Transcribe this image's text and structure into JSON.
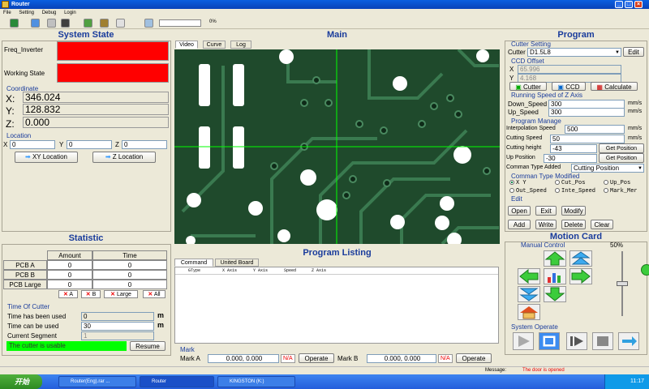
{
  "window": {
    "title": "Router",
    "btn_min": "_",
    "btn_max": "□",
    "btn_close": "×"
  },
  "menu": [
    "File",
    "Setting",
    "Debug",
    "Login"
  ],
  "toolbar": {
    "progress_pct": "0%",
    "progress_value": 0
  },
  "system_state": {
    "title": "System State",
    "freq_inverter_label": "Freq_Inverter",
    "working_state_label": "Working State",
    "coordinate_group": "Coordinate",
    "x_label": "X:",
    "x_value": "346.024",
    "y_label": "Y:",
    "y_value": "128.832",
    "z_label": "Z:",
    "z_value": "0.000",
    "location_group": "Location",
    "loc_x_label": "X",
    "loc_x": "0",
    "loc_y_label": "Y",
    "loc_y": "0",
    "loc_z_label": "Z",
    "loc_z": "0",
    "xy_location_btn": "XY Location",
    "z_location_btn": "Z Location"
  },
  "statistic": {
    "title": "Statistic",
    "headers": [
      "Amount",
      "Time"
    ],
    "rows": [
      {
        "name": "PCB A",
        "amount": "0",
        "time": "0"
      },
      {
        "name": "PCB B",
        "amount": "0",
        "time": "0"
      },
      {
        "name": "PCB Large",
        "amount": "0",
        "time": "0"
      }
    ],
    "clear_a": "A",
    "clear_b": "B",
    "clear_large": "Large",
    "clear_all": "All",
    "time_group": "Time Of Cutter",
    "time_used_label": "Time has been used",
    "time_used": "0",
    "time_used_unit": "m",
    "time_can_label": "Time can be used",
    "time_can": "30",
    "time_can_unit": "m",
    "segment_label": "Current Segment",
    "segment": "1",
    "status": "The cutter is usable",
    "resume_btn": "Resume"
  },
  "main": {
    "title": "Main",
    "tabs": [
      "Video",
      "Curve",
      "Log"
    ]
  },
  "program_listing": {
    "title": "Program Listing",
    "tabs": [
      "Command",
      "United Board"
    ],
    "columns": [
      "GType",
      "X Axis",
      "Y Axis",
      "Speed",
      "Z Axis"
    ],
    "mark_group": "Mark",
    "mark_a_label": "Mark A",
    "mark_a_value": "0.000, 0.000",
    "mark_a_na": "N/A",
    "mark_a_btn": "Operate",
    "mark_b_label": "Mark B",
    "mark_b_value": "0.000, 0.000",
    "mark_b_na": "N/A",
    "mark_b_btn": "Operate"
  },
  "program": {
    "title": "Program",
    "cutter_setting_group": "Cutter Setting",
    "cutter_label": "Cutter",
    "cutter_value": "D1.5L8",
    "edit_btn": "Edit",
    "ccd_offset_group": "CCD Offset",
    "ccd_x_label": "X",
    "ccd_x": "65.996",
    "ccd_y_label": "Y",
    "ccd_y": "4.168",
    "cutter_btn": "Cutter",
    "ccd_btn": "CCD",
    "calculate_btn": "Calculate",
    "z_speed_group": "Running Speed of Z Axis",
    "down_speed_label": "Down_Speed",
    "down_speed": "300",
    "down_unit": "mm/s",
    "up_speed_label": "Up_Speed",
    "up_speed": "300",
    "up_unit": "mm/s",
    "manage_group": "Program Manage",
    "interp_label": "Interpolation Speed",
    "interp": "500",
    "interp_unit": "mm/s",
    "cutting_speed_label": "Cutting Speed",
    "cutting_speed": "50",
    "cutting_unit": "mm/s",
    "cutting_height_label": "Cutting height",
    "cutting_height": "-43",
    "get_pos_1": "Get Position",
    "up_position_label": "Up Position",
    "up_position": "-30",
    "get_pos_2": "Get Position",
    "cmd_type_label": "Comman Type Added",
    "cmd_type": "Cutting Position",
    "cmd_modified_group": "Comman Type Modified",
    "radios": [
      "X Y",
      "Cut_Pos",
      "Up_Pos",
      "Out_Speed",
      "Inte_Speed",
      "Mark_Mer"
    ],
    "edit_group": "Edit",
    "open_btn": "Open",
    "exit_btn": "Exit",
    "modify_btn": "Modify",
    "add_btn": "Add",
    "write_btn": "Write",
    "delete_btn": "Delete",
    "clear_btn": "Clear"
  },
  "motion_card": {
    "title": "Motion Card",
    "manual_group": "Manual Control",
    "speed_pct": "50%",
    "speed_value": 50,
    "system_operate_group": "System Operate"
  },
  "status_bar": {
    "message_label": "Message:",
    "message": "The door is opened"
  },
  "taskbar": {
    "start": "开始",
    "tasks": [
      "Router(Eng).rar ...",
      "Router",
      "KINGSTON (K:)"
    ],
    "clock": "11:17"
  },
  "colors": {
    "alarm": "#ff0000",
    "ok": "#00ff00",
    "title_blue": "#1a3c9c",
    "pcb_green": "#1f4a2c"
  }
}
